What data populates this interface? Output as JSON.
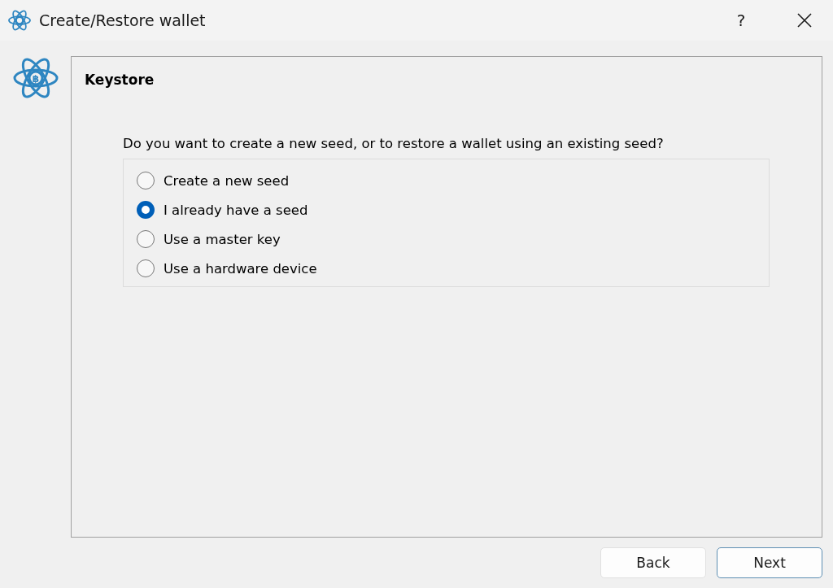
{
  "window": {
    "title": "Create/Restore wallet",
    "help": "?"
  },
  "logo": {
    "symbol": "฿"
  },
  "page": {
    "title": "Keystore",
    "question": "Do you want to create a new seed, or to restore a wallet using an existing seed?"
  },
  "options": [
    {
      "label": "Create a new seed",
      "selected": false
    },
    {
      "label": "I already have a seed",
      "selected": true
    },
    {
      "label": "Use a master key",
      "selected": false
    },
    {
      "label": "Use a hardware device",
      "selected": false
    }
  ],
  "buttons": [
    {
      "label": "Back",
      "focused": false
    },
    {
      "label": "Next",
      "focused": true
    }
  ]
}
